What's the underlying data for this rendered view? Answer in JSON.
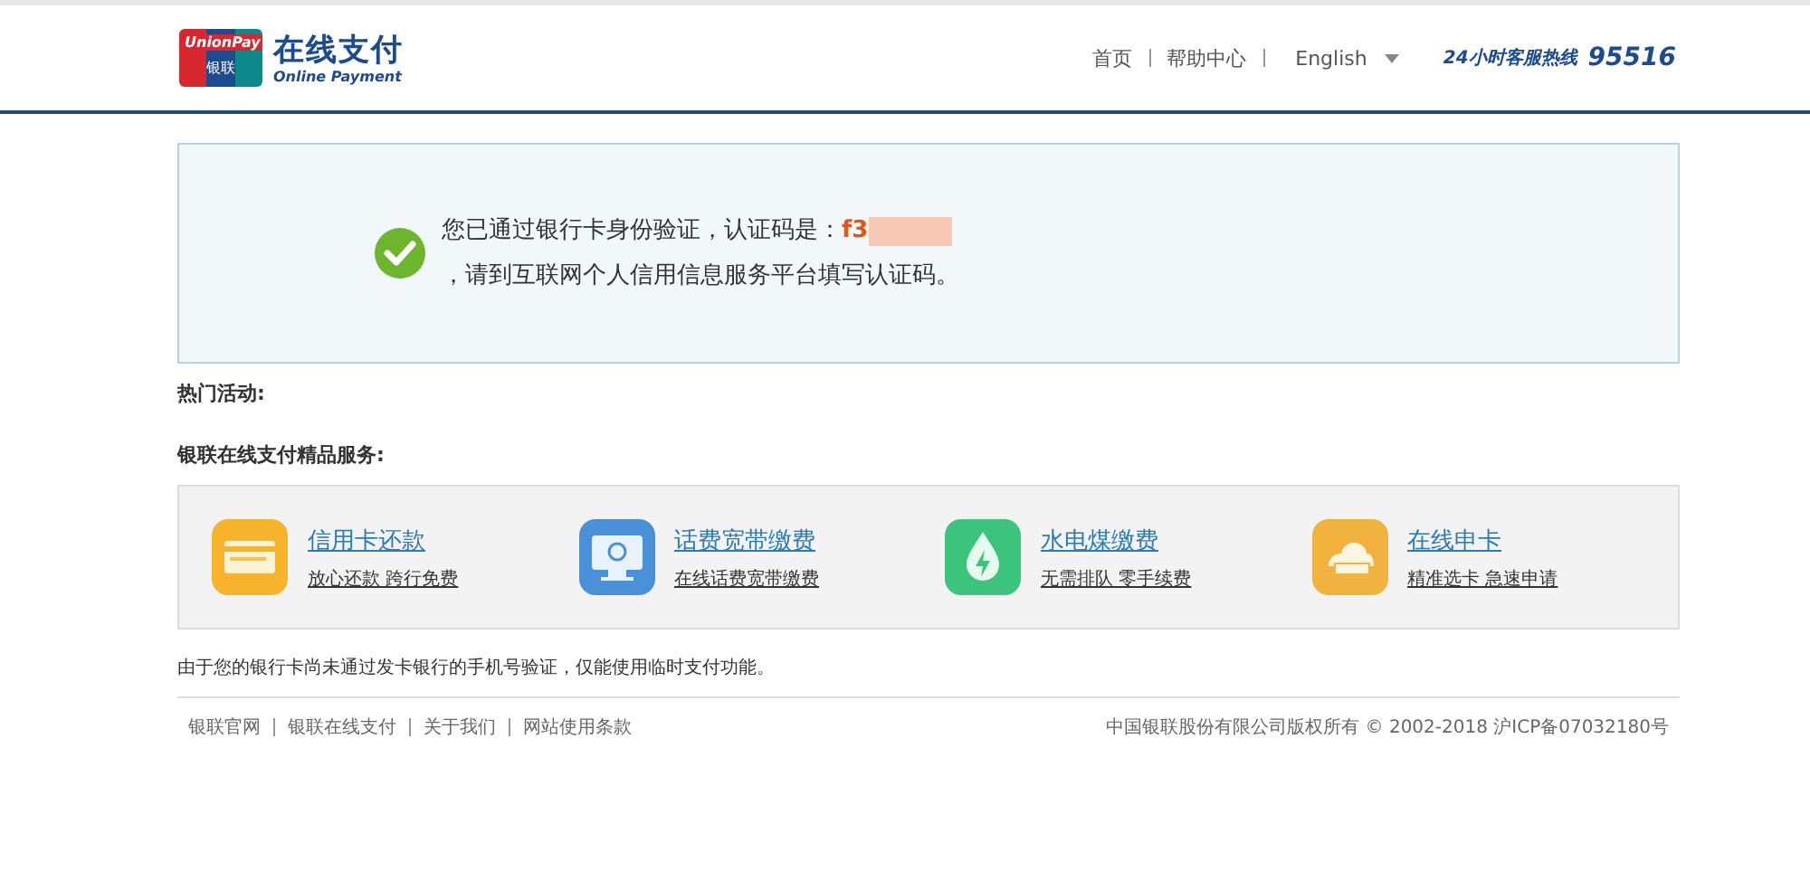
{
  "header": {
    "logo": {
      "card_top": "UnionPay",
      "card_bottom": "银联",
      "title": "在线支付",
      "subtitle": "Online Payment"
    },
    "nav": [
      "首页",
      "帮助中心"
    ],
    "language": "English",
    "hotline_label": "24小时客服热线",
    "hotline_number": "95516"
  },
  "notice": {
    "message": "您已通过银行卡身份验证，认证码是：",
    "code_visible": "f3",
    "code_redacted": true,
    "instruction": "，请到互联网个人信用信息服务平台填写认证码。"
  },
  "hot_activities": {
    "title": "热门活动:"
  },
  "services": {
    "title": "银联在线支付精品服务:",
    "items": [
      {
        "kind": "card",
        "title": "信用卡还款",
        "subtitle": "放心还款 跨行免费"
      },
      {
        "kind": "monitor",
        "title": "话费宽带缴费",
        "subtitle": "在线话费宽带缴费"
      },
      {
        "kind": "drop",
        "title": "水电煤缴费",
        "subtitle": "无需排队 零手续费"
      },
      {
        "kind": "cloud",
        "title": "在线申卡",
        "subtitle": "精准选卡 急速申请"
      }
    ]
  },
  "note": "由于您的银行卡尚未通过发卡银行的手机号验证，仅能使用临时支付功能。",
  "footer": {
    "links": [
      "银联官网",
      "银联在线支付",
      "关于我们",
      "网站使用条款"
    ],
    "copyright": "中国银联股份有限公司版权所有 © 2002-2018 沪ICP备07032180号"
  }
}
